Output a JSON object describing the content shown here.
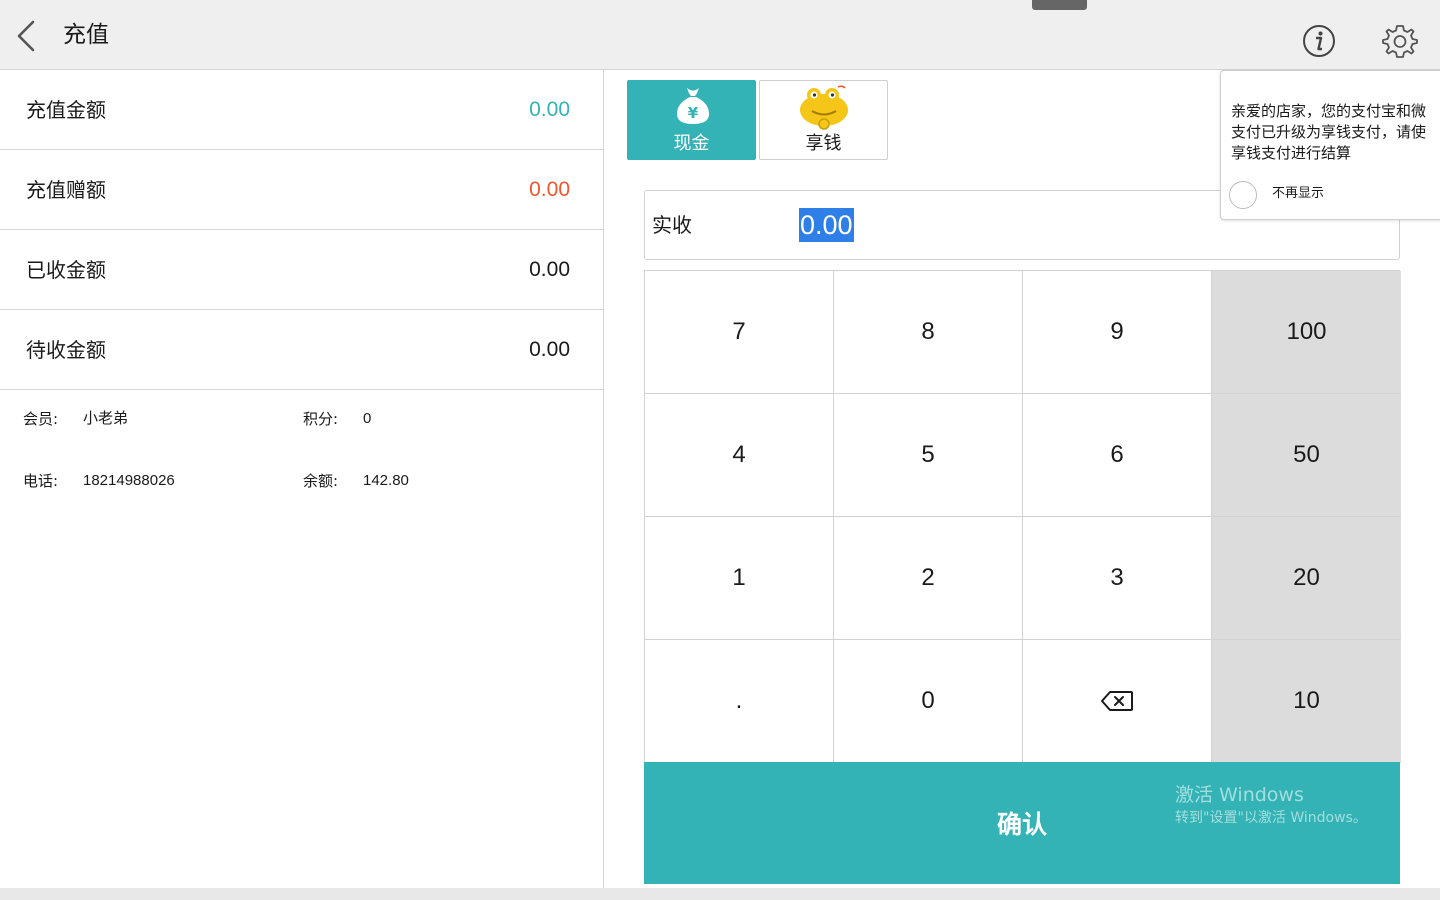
{
  "header": {
    "title": "充值"
  },
  "summary": {
    "rows": [
      {
        "label": "充值金额",
        "value": "0.00",
        "color": "#33b3b5"
      },
      {
        "label": "充值赠额",
        "value": "0.00",
        "color": "#f0562b"
      },
      {
        "label": "已收金额",
        "value": "0.00",
        "color": "#1a1a1a"
      },
      {
        "label": "待收金额",
        "value": "0.00",
        "color": "#1a1a1a"
      }
    ]
  },
  "member": {
    "member_label": "会员:",
    "member_value": "小老弟",
    "points_label": "积分:",
    "points_value": "0",
    "phone_label": "电话:",
    "phone_value": "18214988026",
    "balance_label": "余额:",
    "balance_value": "142.80"
  },
  "payment_methods": [
    {
      "label": "现金",
      "icon": "cash-bag-icon",
      "active": true
    },
    {
      "label": "享钱",
      "icon": "frog-mascot-icon",
      "active": false
    }
  ],
  "received": {
    "label": "实收",
    "value": "0.00"
  },
  "keypad": {
    "keys": [
      "7",
      "8",
      "9",
      "100",
      "4",
      "5",
      "6",
      "50",
      "1",
      "2",
      "3",
      "20",
      ".",
      "0",
      "⌫",
      "10"
    ],
    "backspace_icon": "backspace-icon"
  },
  "confirm": {
    "label": "确认"
  },
  "popup": {
    "lines": [
      "亲爱的店家，您的支付宝和微",
      "支付已升级为享钱支付，请使",
      "享钱支付进行结算"
    ],
    "checkbox_label": "不再显示"
  },
  "watermark": {
    "line1": "激活 Windows",
    "line2": "转到\"设置\"以激活 Windows。"
  },
  "colors": {
    "accent": "#33b3b5",
    "gift": "#f0562b",
    "quick_key_bg": "#dcdcdc",
    "selection": "#2f7fe8"
  }
}
